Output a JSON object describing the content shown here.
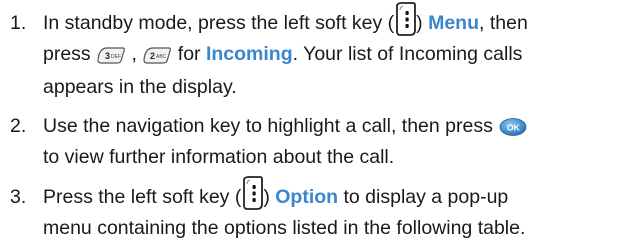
{
  "colors": {
    "text": "#1a1a1a",
    "accent": "#3a86cf"
  },
  "icons": {
    "soft_key": "left-soft-key-icon",
    "key3": "key-3-def-icon",
    "key2": "key-2-abc-icon",
    "ok": "ok-key-icon"
  },
  "steps": [
    {
      "number": "1.",
      "a": "In standby mode, press the left soft key (",
      "b": ") ",
      "link": "Menu",
      "c": ", then",
      "d": "press ",
      "e": " , ",
      "f": " for ",
      "link2": "Incoming",
      "g": ". Your list of Incoming calls",
      "h": "appears in the display."
    },
    {
      "number": "2.",
      "a": "Use the navigation key to highlight a call, then press ",
      "b": "to view further information about the call."
    },
    {
      "number": "3.",
      "a": "Press the left soft key (",
      "b": ") ",
      "link": "Option",
      "c": " to display a pop-up",
      "d": "menu containing the options listed in the following table."
    }
  ]
}
